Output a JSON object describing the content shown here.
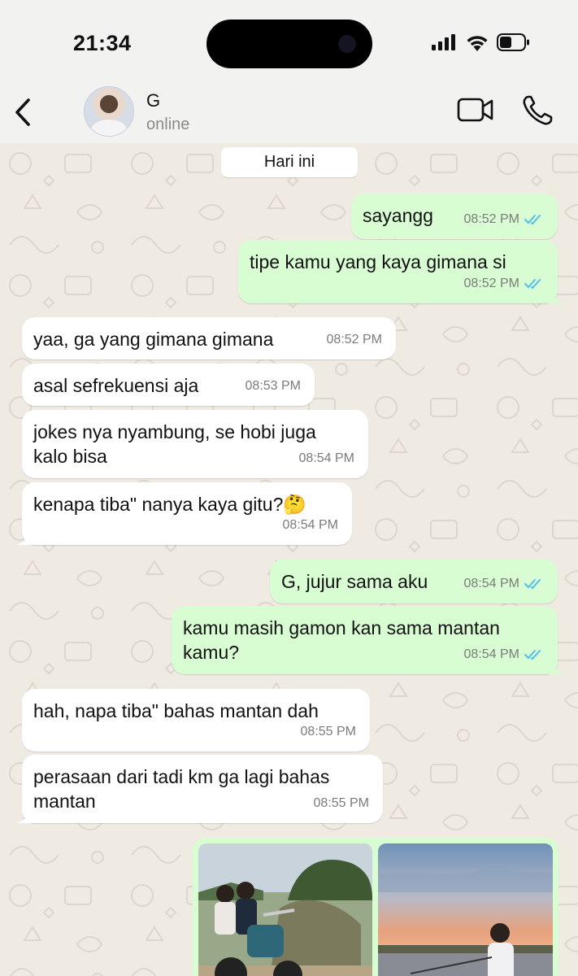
{
  "status_bar": {
    "time": "21:34"
  },
  "header": {
    "name": "G",
    "status": "online"
  },
  "date_chip": "Hari ini",
  "messages": [
    {
      "dir": "out",
      "lines": [
        "sayangg"
      ],
      "time": "08:52 PM",
      "read": true
    },
    {
      "dir": "out",
      "lines": [
        "tipe kamu yang kaya gimana si"
      ],
      "time": "08:52 PM",
      "read": true
    },
    {
      "dir": "in",
      "lines": [
        "yaa, ga yang gimana gimana"
      ],
      "time": "08:52 PM"
    },
    {
      "dir": "in",
      "lines": [
        "asal sefrekuensi aja"
      ],
      "time": "08:53 PM"
    },
    {
      "dir": "in",
      "lines": [
        "jokes nya nyambung, se hobi juga",
        "kalo bisa"
      ],
      "time": "08:54 PM"
    },
    {
      "dir": "in",
      "lines": [
        "kenapa tiba\" nanya kaya gitu?🤔"
      ],
      "time": "08:54 PM"
    },
    {
      "dir": "out",
      "lines": [
        "G, jujur sama aku"
      ],
      "time": "08:54 PM",
      "read": true
    },
    {
      "dir": "out",
      "lines": [
        "kamu masih gamon kan sama mantan",
        "kamu?"
      ],
      "time": "08:54 PM",
      "read": true
    },
    {
      "dir": "in",
      "lines": [
        "hah, napa tiba\" bahas mantan dah"
      ],
      "time": "08:55 PM"
    },
    {
      "dir": "in",
      "lines": [
        "perasaan dari tadi km ga lagi bahas",
        "mantan"
      ],
      "time": "08:55 PM"
    }
  ],
  "colors": {
    "incoming_bubble": "#ffffff",
    "outgoing_bubble": "#d9fdd3",
    "read_ticks": "#53bdeb",
    "wallpaper": "#efeae2"
  },
  "icons": [
    "back-icon",
    "video-call-icon",
    "phone-icon",
    "signal-icon",
    "wifi-icon",
    "battery-icon",
    "double-check-icon"
  ]
}
